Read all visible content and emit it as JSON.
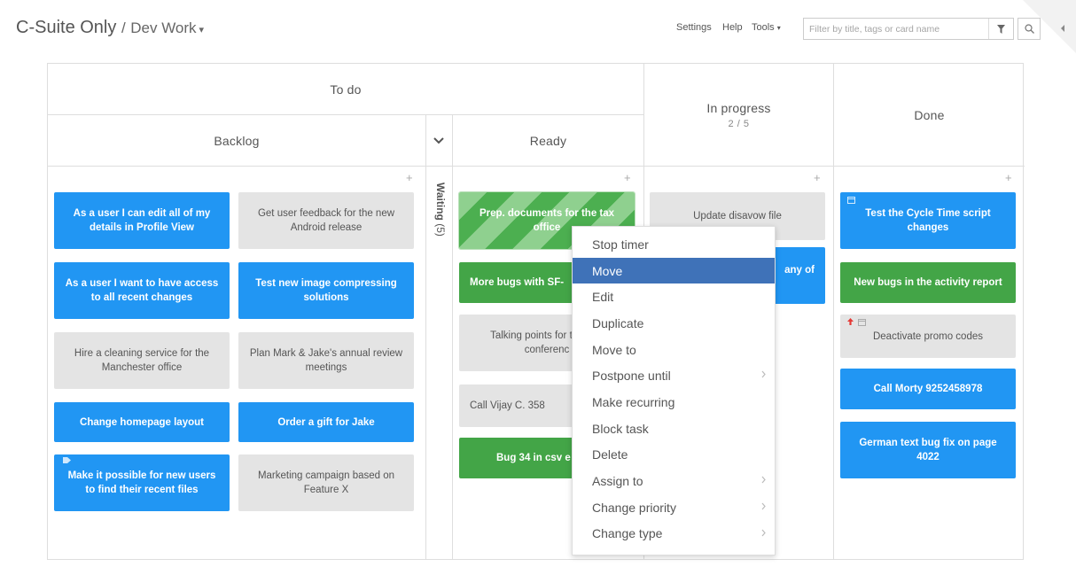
{
  "header": {
    "workspace": "C-Suite Only",
    "separator": "/",
    "board": "Dev Work",
    "board_caret": "▾",
    "nav": {
      "settings": "Settings",
      "help": "Help",
      "tools": "Tools"
    },
    "tools_caret": "▾",
    "search": {
      "placeholder": "Filter by title, tags or card name",
      "value": ""
    }
  },
  "icons": {
    "filter": "filter-icon",
    "search": "search-icon",
    "panel_toggle": "chevron-left-icon",
    "add": "plus-icon",
    "collapse": "chevron-down-icon",
    "submenu": "chevron-right-icon",
    "calendar": "calendar-icon",
    "priority": "arrow-up-icon",
    "tag": "tag-icon"
  },
  "colors": {
    "blue": "#2196f3",
    "green": "#43a547",
    "gray": "#e4e4e4",
    "menu_active": "#3f72b8",
    "priority": "#e53935"
  },
  "plus_symbol": "+",
  "board": {
    "todo_header": "To do",
    "backlog_header": "Backlog",
    "ready_header": "Ready",
    "inprogress_header": "In progress",
    "inprogress_wip": "2 / 5",
    "done_header": "Done",
    "waiting_label": "Waiting",
    "waiting_count": "(5)"
  },
  "cards": {
    "backlog_col1": [
      "As a user I can edit all of my details in Profile View",
      "As a user I want to have access to all recent changes",
      "Hire a cleaning service for the Manchester office",
      "Change homepage layout",
      "Make it possible for new users to find their recent files"
    ],
    "backlog_col2": [
      "Get user feedback for the new Android release",
      "Test new image compressing solutions",
      "Plan Mark & Jake's annual review meetings",
      "Order a gift for Jake",
      "Marketing campaign based on Feature X"
    ],
    "ready": [
      "Prep. documents for the tax office",
      "More bugs with SF-",
      "Talking points for th team conferenc",
      "Call Vijay C. 358",
      "Bug 34 in csv e"
    ],
    "inprogress": [
      "Update disavow file",
      "any of"
    ],
    "done": [
      "Test the Cycle Time script changes",
      "New bugs in the activity report",
      "Deactivate promo codes",
      "Call Morty 9252458978",
      "German text bug fix on page 4022"
    ]
  },
  "context_menu": {
    "items": [
      {
        "label": "Stop timer",
        "submenu": false
      },
      {
        "label": "Move",
        "submenu": false,
        "active": true
      },
      {
        "label": "Edit",
        "submenu": false
      },
      {
        "label": "Duplicate",
        "submenu": false
      },
      {
        "label": "Move to",
        "submenu": false
      },
      {
        "label": "Postpone until",
        "submenu": true
      },
      {
        "label": "Make recurring",
        "submenu": false
      },
      {
        "label": "Block task",
        "submenu": false
      },
      {
        "label": "Delete",
        "submenu": false
      },
      {
        "label": "Assign to",
        "submenu": true
      },
      {
        "label": "Change priority",
        "submenu": true
      },
      {
        "label": "Change type",
        "submenu": true
      }
    ]
  }
}
